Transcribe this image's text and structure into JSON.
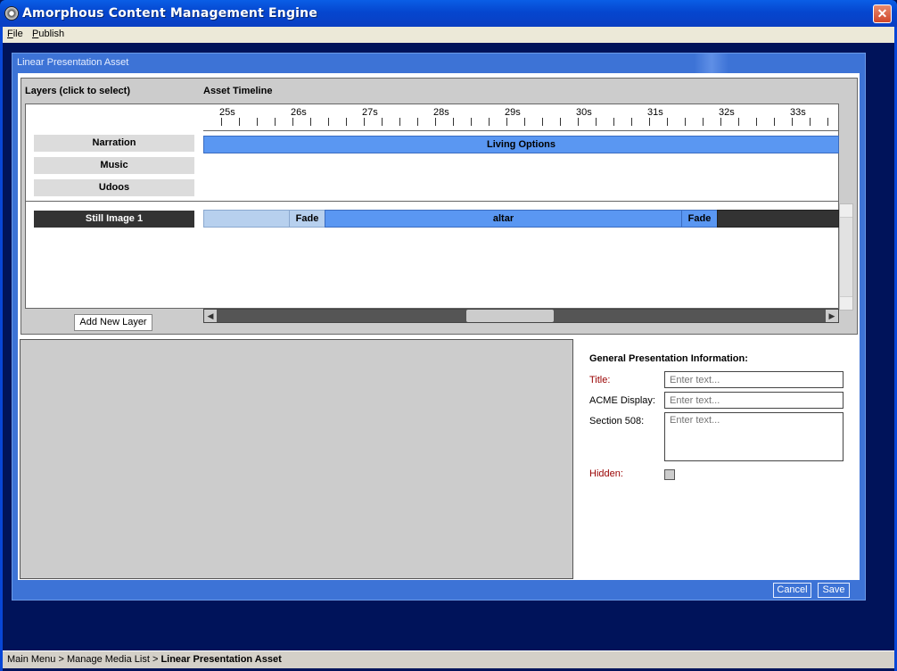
{
  "window": {
    "title": "Amorphous Content Management Engine",
    "close_symbol": "✕"
  },
  "menu": [
    {
      "label": "File"
    },
    {
      "label": "Publish"
    }
  ],
  "dialog": {
    "title": "Linear Presentation Asset"
  },
  "layers": {
    "header": "Layers   (click to select)",
    "items": [
      {
        "label": "Narration",
        "selected": false
      },
      {
        "label": "Music",
        "selected": false
      },
      {
        "label": "Udoos",
        "selected": false
      },
      {
        "label": "Still Image 1",
        "selected": true
      }
    ],
    "add_button": "Add New Layer"
  },
  "timeline": {
    "header": "Asset Timeline",
    "ticks": [
      "25s",
      "26s",
      "27s",
      "28s",
      "29s",
      "30s",
      "31s",
      "32s",
      "33s"
    ],
    "clips": [
      {
        "label": "Living Options",
        "style": "blue"
      },
      {
        "label": "",
        "style": "light"
      },
      {
        "label": "Fade",
        "style": "light"
      },
      {
        "label": "altar",
        "style": "blue"
      },
      {
        "label": "Fade",
        "style": "blue"
      },
      {
        "label": "",
        "style": "dark"
      }
    ],
    "scroll_left": "◀",
    "scroll_right": "▶"
  },
  "form": {
    "heading": "General Presentation Information:",
    "title_label": "Title:",
    "title_placeholder": "Enter text...",
    "display_label": "ACME Display:",
    "display_placeholder": "Enter text...",
    "section508_label": "Section 508:",
    "section508_placeholder": "Enter text...",
    "hidden_label": "Hidden:",
    "hidden_checked": false
  },
  "buttons": {
    "cancel": "Cancel",
    "save": "Save"
  },
  "breadcrumb": {
    "path": "Main Menu > Manage Media List > ",
    "current": "Linear Presentation Asset"
  },
  "colors": {
    "accent": "#3d73d6",
    "clip_blue": "#5a97f2",
    "required_label": "#990000"
  }
}
